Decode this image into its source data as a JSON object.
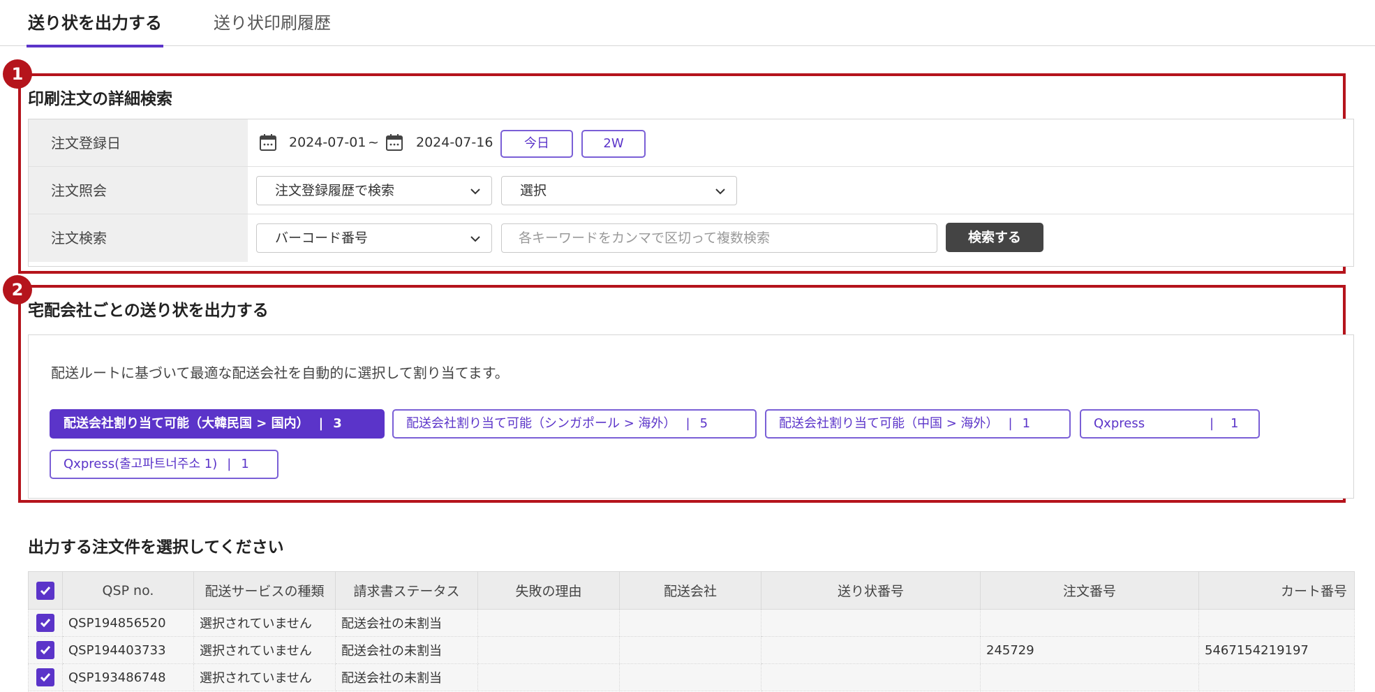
{
  "tabs": [
    {
      "label": "送り状を出力する",
      "active": true
    },
    {
      "label": "送り状印刷履歴",
      "active": false
    }
  ],
  "annotations": [
    "1",
    "2"
  ],
  "search": {
    "title": "印刷注文の詳細検索",
    "rows": {
      "date": {
        "label": "注文登録日",
        "from": "2024-07-01",
        "separator": "~",
        "to": "2024-07-16",
        "today_button": "今日",
        "two_week_button": "2W"
      },
      "lookup": {
        "label": "注文照会",
        "select1": "注文登録履歴で検索",
        "select2": "選択"
      },
      "keyword": {
        "label": "注文検索",
        "select": "バーコード番号",
        "placeholder": "各キーワードをカンマで区切って複数検索",
        "search_button": "検索する"
      }
    }
  },
  "courier": {
    "title": "宅配会社ごとの送り状を出力する",
    "description": "配送ルートに基づいて最適な配送会社を自動的に選択して割り当てます。",
    "chips": [
      {
        "label": "配送会社割り当て可能（大韓民国 > 国内）",
        "count": "3",
        "active": true
      },
      {
        "label": "配送会社割り当て可能（シンガポール > 海外）",
        "count": "5",
        "active": false
      },
      {
        "label": "配送会社割り当て可能（中国 > 海外）",
        "count": "1",
        "active": false
      },
      {
        "label": "Qxpress",
        "count": "1",
        "active": false
      },
      {
        "label": "Qxpress(출고파트너주소 1)",
        "count": "1",
        "active": false
      }
    ]
  },
  "orders": {
    "title": "出力する注文件を選択してください",
    "columns": [
      "QSP no.",
      "配送サービスの種類",
      "請求書ステータス",
      "失敗の理由",
      "配送会社",
      "送り状番号",
      "注文番号",
      "カート番号"
    ],
    "rows": [
      [
        "QSP194856520",
        "選択されていません",
        "配送会社の未割当",
        "",
        "",
        "",
        "",
        ""
      ],
      [
        "QSP194403733",
        "選択されていません",
        "配送会社の未割当",
        "",
        "",
        "",
        "245729",
        "5467154219197"
      ],
      [
        "QSP193486748",
        "選択されていません",
        "配送会社の未割当",
        "",
        "",
        "",
        "",
        ""
      ]
    ]
  },
  "colors": {
    "accent": "#5b34c9",
    "annotation": "#b5141c",
    "dark_button": "#444444"
  }
}
